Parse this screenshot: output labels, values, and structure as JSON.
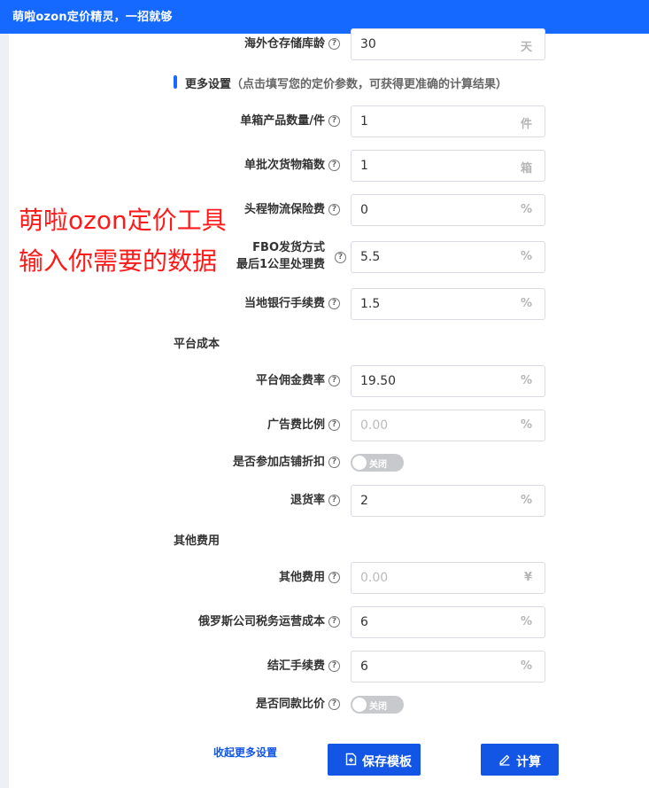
{
  "header": {
    "title": "萌啦ozon定价精灵，一招就够"
  },
  "storage_age": {
    "label": "海外仓存储库龄",
    "value": "30",
    "unit": "天"
  },
  "more_settings": {
    "title": "更多设置",
    "hint": "（点击填写您的定价参数，可获得更准确的计算结果）"
  },
  "fields": {
    "units_per_box": {
      "label": "单箱产品数量/件",
      "value": "1",
      "unit": "件"
    },
    "boxes_per_batch": {
      "label": "单批次货物箱数",
      "value": "1",
      "unit": "箱"
    },
    "logistics_insurance": {
      "label": "头程物流保险费",
      "value": "0",
      "unit": "%"
    },
    "fbo_last_mile": {
      "label_line1": "FBO发货方式",
      "label_line2": "最后1公里处理费",
      "value": "5.5",
      "unit": "%"
    },
    "bank_fee": {
      "label": "当地银行手续费",
      "value": "1.5",
      "unit": "%"
    }
  },
  "platform_costs": {
    "title": "平台成本",
    "commission": {
      "label": "平台佣金费率",
      "value": "19.50",
      "unit": "%"
    },
    "ad_ratio": {
      "label": "广告费比例",
      "placeholder": "0.00",
      "unit": "%"
    },
    "store_discount": {
      "label": "是否参加店铺折扣",
      "toggle": "关闭"
    },
    "return_rate": {
      "label": "退货率",
      "value": "2",
      "unit": "%"
    }
  },
  "other_costs": {
    "title": "其他费用",
    "other_fee": {
      "label": "其他费用",
      "placeholder": "0.00",
      "unit": "¥"
    },
    "russia_tax": {
      "label": "俄罗斯公司税务运营成本",
      "value": "6",
      "unit": "%"
    },
    "settlement_fee": {
      "label": "结汇手续费",
      "value": "6",
      "unit": "%"
    },
    "same_price_compare": {
      "label": "是否同款比价",
      "toggle": "关闭"
    }
  },
  "actions": {
    "collapse": "收起更多设置",
    "save_template": "保存模板",
    "calculate": "计算"
  },
  "overlay": {
    "line1": "萌啦ozon定价工具",
    "line2": "输入你需要的数据"
  },
  "colors": {
    "header": "#1669ff",
    "primary_button": "#1356e6",
    "overlay_text": "#ff1a1a",
    "toggle_off": "#c8c9cc"
  }
}
